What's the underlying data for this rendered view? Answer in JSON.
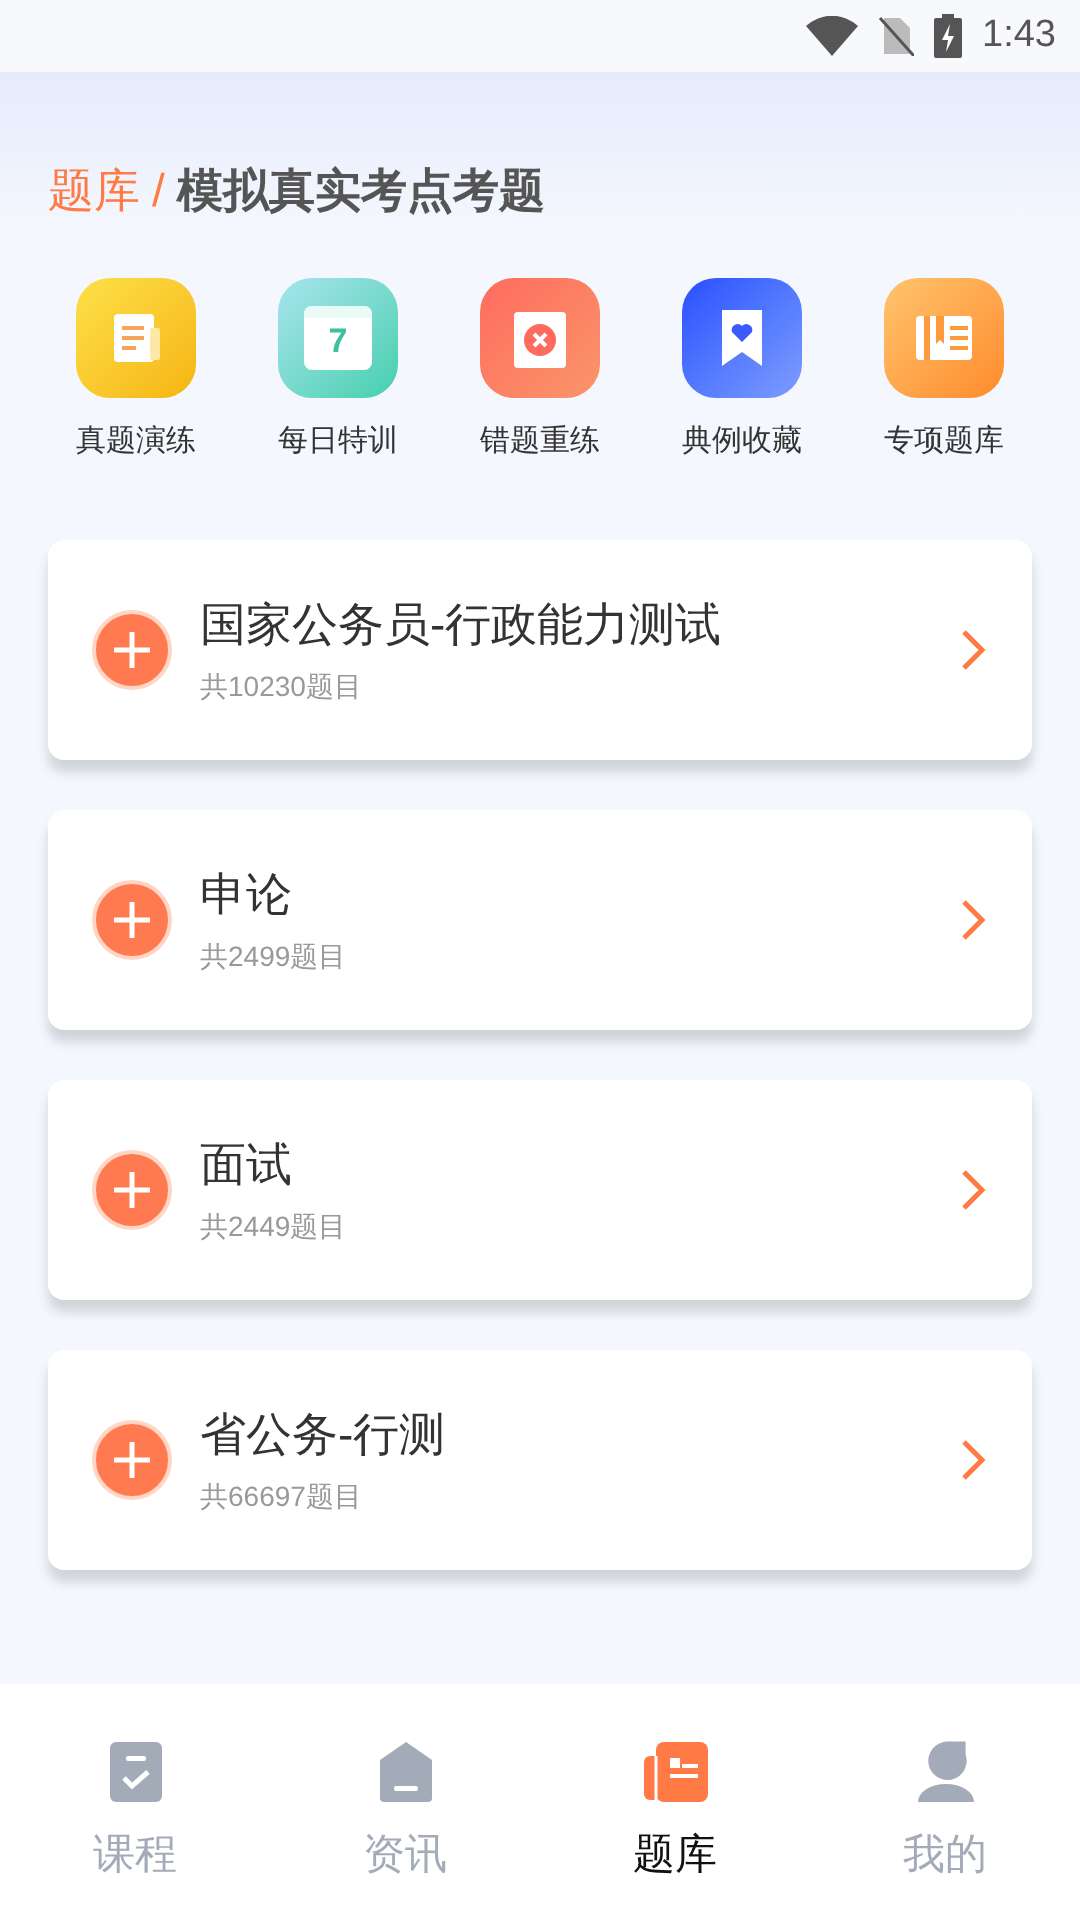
{
  "status_bar": {
    "time": "1:43"
  },
  "header": {
    "section": "题库",
    "separator": "/",
    "subtitle": "模拟真实考点考题"
  },
  "shortcuts": [
    {
      "label": "真题演练",
      "kind": "paper"
    },
    {
      "label": "每日特训",
      "kind": "calendar",
      "glyph": "7"
    },
    {
      "label": "错题重练",
      "kind": "wrong"
    },
    {
      "label": "典例收藏",
      "kind": "bookmark"
    },
    {
      "label": "专项题库",
      "kind": "book"
    }
  ],
  "banks": [
    {
      "title": "国家公务员-行政能力测试",
      "count": "共10230题目"
    },
    {
      "title": "申论",
      "count": "共2499题目"
    },
    {
      "title": "面试",
      "count": "共2449题目"
    },
    {
      "title": "省公务-行测",
      "count": "共66697题目"
    }
  ],
  "tabs": [
    {
      "label": "课程",
      "kind": "course",
      "selected": false
    },
    {
      "label": "资讯",
      "kind": "news",
      "selected": false
    },
    {
      "label": "题库",
      "kind": "bank",
      "selected": true
    },
    {
      "label": "我的",
      "kind": "me",
      "selected": false
    }
  ]
}
